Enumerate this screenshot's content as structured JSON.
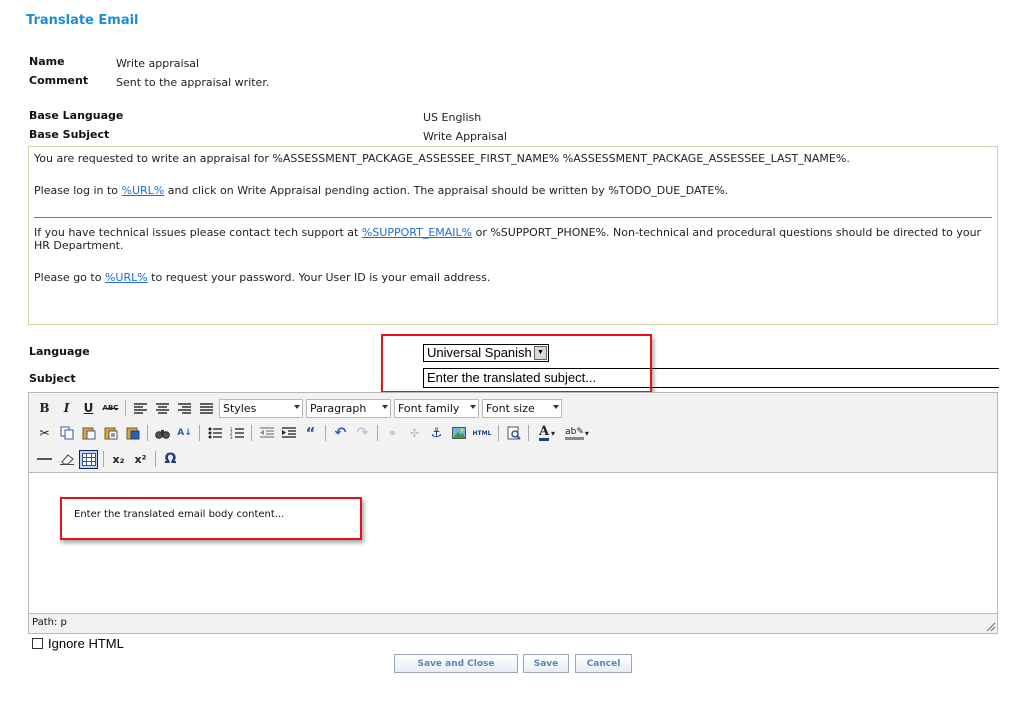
{
  "page": {
    "title": "Translate Email"
  },
  "meta": {
    "name_label": "Name",
    "name_value": "Write appraisal",
    "comment_label": "Comment",
    "comment_value": "Sent to the appraisal writer."
  },
  "base": {
    "language_label": "Base Language",
    "language_value": "US English",
    "subject_label": "Base Subject",
    "subject_value": "Write Appraisal",
    "body": {
      "p1": "You are requested to write an appraisal for %ASSESSMENT_PACKAGE_ASSESSEE_FIRST_NAME% %ASSESSMENT_PACKAGE_ASSESSEE_LAST_NAME%.",
      "p2_before": "Please log in to ",
      "p2_link": "%URL%",
      "p2_after": " and click on Write Appraisal pending action. The appraisal should be written by %TODO_DUE_DATE%.",
      "p3_before": "If you have technical issues please contact tech support at ",
      "p3_link": "%SUPPORT_EMAIL%",
      "p3_after": " or %SUPPORT_PHONE%. Non-technical and procedural questions should be directed to your HR Department.",
      "p4_before": "Please go to ",
      "p4_link": "%URL%",
      "p4_after": " to request your password. Your User ID is your email address."
    }
  },
  "translation": {
    "language_label": "Language",
    "language_selected": "Universal Spanish",
    "subject_label": "Subject",
    "subject_placeholder": "Enter the translated subject..."
  },
  "editor": {
    "styles": "Styles",
    "format": "Paragraph",
    "font_family": "Font family",
    "font_size": "Font size",
    "body_placeholder": "Enter the translated email body content...",
    "path_label": "Path: p",
    "icon_bold": "B",
    "icon_italic": "I",
    "icon_underline": "U",
    "icon_strike": "ABC",
    "icon_html": "HTML",
    "icon_sub": "x₂",
    "icon_sup": "x²",
    "icon_omega": "Ω"
  },
  "options": {
    "ignore_html_label": "Ignore HTML"
  },
  "actions": {
    "save_close": "Save and Close",
    "save": "Save",
    "cancel": "Cancel"
  },
  "colors": {
    "title": "#1a8fd6",
    "highlight": "#e8111b",
    "link": "#1a6fd6"
  }
}
